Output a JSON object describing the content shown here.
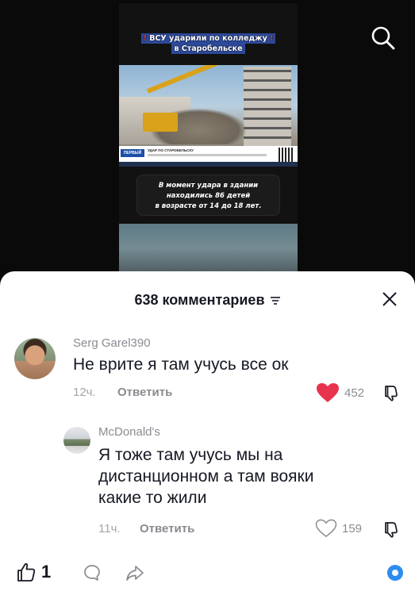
{
  "video": {
    "title_line1": "ВСУ ударили по колледжу",
    "title_line2": "в Старобельске",
    "title_bang": "!",
    "news_logo": "ПЕРВЫЙ",
    "news_headline": "УДАР ПО СТАРОБЕЛЬСКУ",
    "caption_lines": [
      "В момент удара в здании",
      "находились 86 детей",
      "в возрасте от 14 до 18 лет."
    ]
  },
  "comments_sheet": {
    "count_title": "638 комментариев",
    "comments": [
      {
        "username": "Serg Garel390",
        "text": "Не врите я там учусь все ок",
        "time": "12ч.",
        "reply_label": "Ответить",
        "likes": "452",
        "liked": true
      },
      {
        "username": "McDonald's",
        "text_lines": [
          "Я тоже там учусь мы на",
          "дистанционном а там вояки",
          "какие то жили"
        ],
        "time": "11ч.",
        "reply_label": "Ответить",
        "likes": "159",
        "liked": false
      }
    ]
  },
  "bottom_bar": {
    "like_count": "1"
  },
  "colors": {
    "liked_heart": "#fe2c55",
    "text_primary": "#161823",
    "text_secondary": "#8a8b91",
    "badge_blue": "#2d8cf0"
  },
  "icons": [
    "search-icon",
    "filter-icon",
    "close-icon",
    "heart-icon",
    "dislike-icon",
    "thumbs-up-icon",
    "comment-bubble-icon",
    "share-arrow-icon",
    "badge-icon"
  ]
}
